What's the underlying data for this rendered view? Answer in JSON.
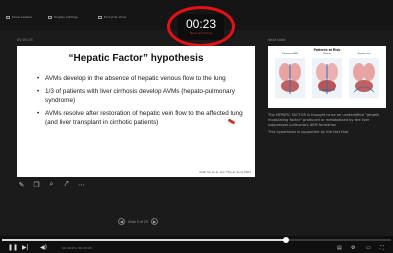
{
  "toolbar": {
    "items": [
      {
        "label": "Show taskbar",
        "icon": "taskbar-icon"
      },
      {
        "label": "Display settings",
        "icon": "display-icon"
      },
      {
        "label": "End slide show",
        "icon": "end-show-icon"
      }
    ]
  },
  "timer": {
    "value": "00:23",
    "caption": "Now recording"
  },
  "panes": {
    "current_label": "00:00:25",
    "next_label": "Next slide"
  },
  "slide": {
    "title": "“Hepatic Factor” hypothesis",
    "bullets": [
      "AVMs develop in the absence of hepatic venous flow to the lung",
      "1/3 of patients with liver cirrhosis develop AVMs (hepato-pulmonary syndrome)",
      "AVMs resolve after restoration of hepatic vein flow to the affected lung (and liver transplant in cirrhotic patients)"
    ],
    "citation": "Shah SA et al. Ann Thorac Surg 2007"
  },
  "tools": [
    "pen-icon",
    "copy-icon",
    "zoom-icon",
    "pointer-icon",
    "more-icon"
  ],
  "nav": {
    "text": "Slide 5 of 25"
  },
  "next_slide": {
    "title": "Patients at Risk",
    "figure_captions": [
      "Pulmonary AVM",
      "Normal",
      "Hepatic vein"
    ]
  },
  "notes": {
    "paragraphs": [
      "The HEPATIC FACTOR is thought to be an unidentified \"growth modulating factor\" produced or metabolized by the liver suppresses pulmonary AVM formation",
      "This hypothesis is supported by the fact that"
    ]
  },
  "player": {
    "time": "00:00:25 / 00:03:25",
    "progress": 0.73
  },
  "colors": {
    "timer_ring": "#e80f17",
    "background": "#1b1b1b",
    "slide_bg": "#ffffff"
  }
}
